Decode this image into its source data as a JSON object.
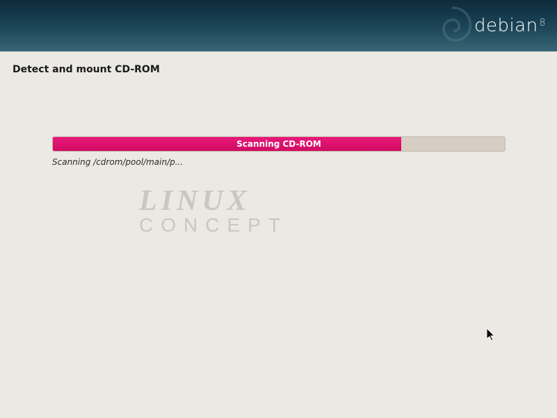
{
  "header": {
    "brand": "debian",
    "version": "8"
  },
  "page": {
    "title": "Detect and mount CD-ROM"
  },
  "progress": {
    "label": "Scanning CD-ROM",
    "percent": 77,
    "status": "Scanning /cdrom/pool/main/p..."
  },
  "watermark": {
    "line1": "LINUX",
    "line2": "CONCEPT"
  }
}
